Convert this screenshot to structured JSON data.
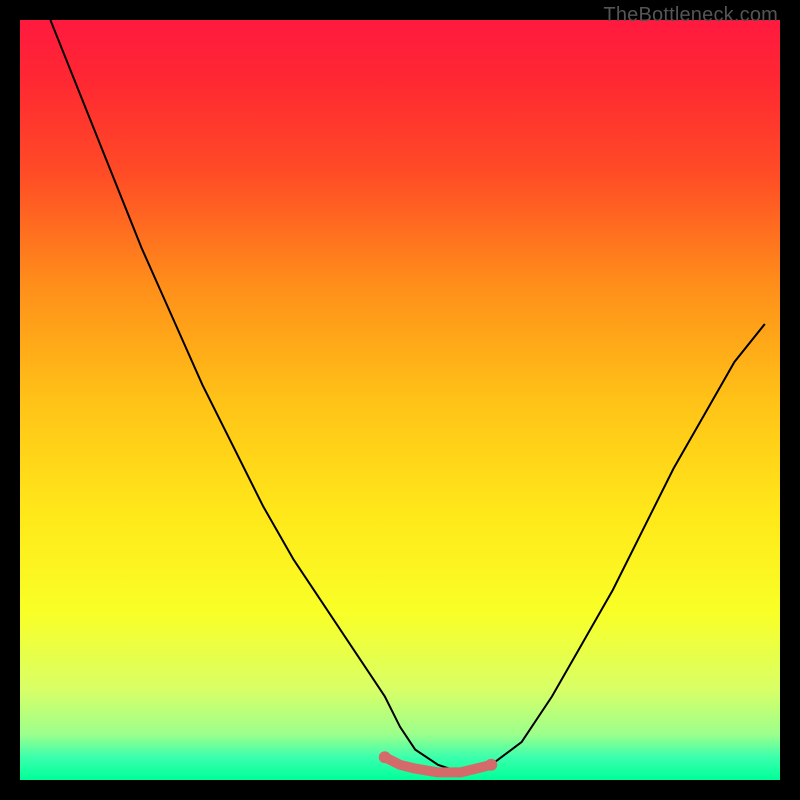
{
  "watermark": "TheBottleneck.com",
  "colors": {
    "background": "#000000",
    "curve": "#000000",
    "bottom_segment": "#d46a6a",
    "gradient_top": "#ff193f",
    "gradient_bottom": "#00ff99"
  },
  "chart_data": {
    "type": "line",
    "title": "",
    "xlabel": "",
    "ylabel": "",
    "xlim": [
      0,
      100
    ],
    "ylim": [
      0,
      100
    ],
    "series": [
      {
        "name": "main-curve",
        "x": [
          4,
          8,
          12,
          16,
          20,
          24,
          28,
          32,
          36,
          40,
          44,
          46,
          48,
          50,
          52,
          55,
          58,
          60,
          62,
          66,
          70,
          74,
          78,
          82,
          86,
          90,
          94,
          98
        ],
        "y": [
          100,
          90,
          80,
          70,
          61,
          52,
          44,
          36,
          29,
          23,
          17,
          14,
          11,
          7,
          4,
          2,
          1,
          1,
          2,
          5,
          11,
          18,
          25,
          33,
          41,
          48,
          55,
          60
        ]
      },
      {
        "name": "bottom-highlight",
        "x": [
          48,
          50,
          52,
          55,
          58,
          60,
          62
        ],
        "y": [
          3,
          2,
          1.5,
          1,
          1,
          1.5,
          2
        ]
      }
    ]
  }
}
